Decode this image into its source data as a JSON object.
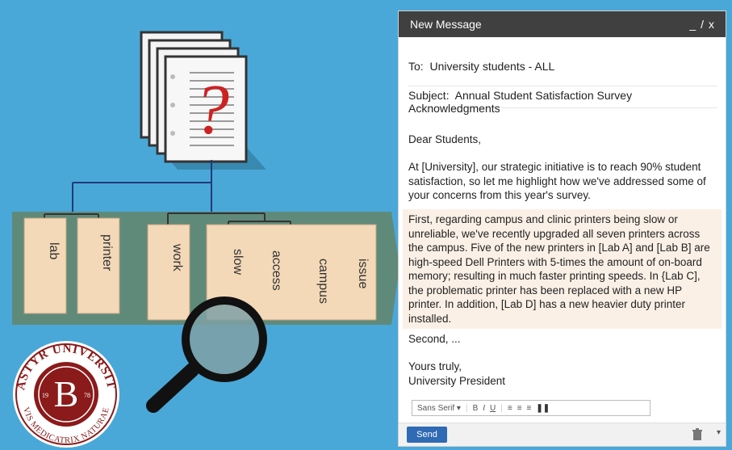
{
  "colors": {
    "background": "#4aa8d8",
    "band": "#5f8a7a",
    "box": "#f3d9b8",
    "tree_line": "#1f3a7a",
    "branch_line": "#333333",
    "email_header": "#404040",
    "highlight": "#fbf0e6",
    "send_button": "#2f6ab4",
    "question_mark": "#cc2222",
    "seal": "#8b1a1a"
  },
  "diagram": {
    "boxes": [
      {
        "label": "lab"
      },
      {
        "label": "printer"
      },
      {
        "label": "work"
      }
    ],
    "inner_labels": [
      "slow",
      "access",
      "campus",
      "issue"
    ],
    "document_icon": "document-stack-question-icon",
    "magnifier_icon": "magnifying-glass-icon"
  },
  "seal": {
    "arc_top": "BASTYR UNIVERSITY",
    "arc_bottom": "VIS MEDICATRIX NATURAE",
    "year_left": "19",
    "year_right": "78",
    "monogram": "B"
  },
  "email": {
    "header_title": "New Message",
    "minimize": "_",
    "separator": "/",
    "close": "x",
    "to_label": "To:",
    "to_value": "University students - ALL",
    "subject_label": "Subject:",
    "subject_value": "Annual Student Satisfaction Survey Acknowledgments",
    "greeting": "Dear Students,",
    "para1": "At  [University], our strategic initiative is to reach 90% student satisfaction, so let me highlight how we've addressed some of your concerns from this year's survey.",
    "para2": "First, regarding campus and clinic printers being slow or unreliable, we've recently upgraded all seven printers across the campus. Five of the new printers in [Lab A] and [Lab B] are high-speed Dell Printers with 5-times the amount of on-board memory; resulting in much faster printing speeds.  In {Lab C], the problematic printer has been replaced with a new HP printer. In addition, [Lab D] has a new heavier duty printer installed.",
    "para3": "Second, ...",
    "sign_off": "Yours truly,",
    "signature": "University President",
    "toolbar": {
      "font": "Sans Serif",
      "font_arrow": "▾",
      "bold": "B",
      "italic": "I",
      "underline": "U",
      "align_left": "≡",
      "align_center": "≡",
      "align_right": "≡",
      "quote": "❚❚"
    },
    "send_label": "Send",
    "trash_icon": "trash-icon",
    "more_arrow": "▾"
  }
}
